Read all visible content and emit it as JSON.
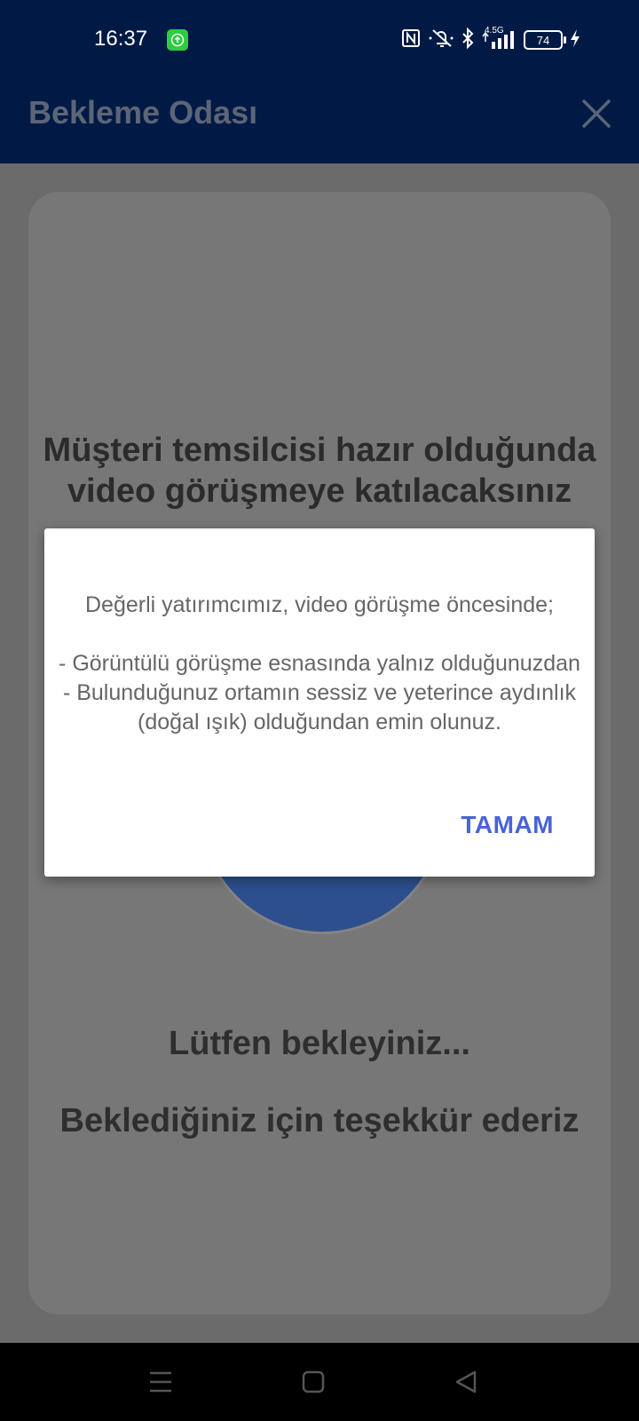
{
  "status_bar": {
    "time": "16:37",
    "battery": "74",
    "network_label": "4.5G"
  },
  "app_bar": {
    "title": "Bekleme Odası",
    "close_icon": "close-icon"
  },
  "waiting_room": {
    "heading": "Müşteri temsilcisi hazır olduğunda video görüşmeye katılacaksınız",
    "wait_text": "Lütfen bekleyiniz...",
    "thanks_text": "Beklediğiniz için teşekkür ederiz"
  },
  "dialog": {
    "line1": "Değerli yatırımcımız, video görüşme öncesinde;",
    "line2": "- Görüntülü görüşme esnasında yalnız olduğunuzdan",
    "line3": "- Bulunduğunuz ortamın sessiz ve yeterince aydınlık (doğal ışık) olduğundan emin olunuz.",
    "ok_label": "TAMAM"
  },
  "colors": {
    "app_bar": "#001a45",
    "accent_button": "#4a63d6",
    "spinner": "#2d4f8e"
  }
}
